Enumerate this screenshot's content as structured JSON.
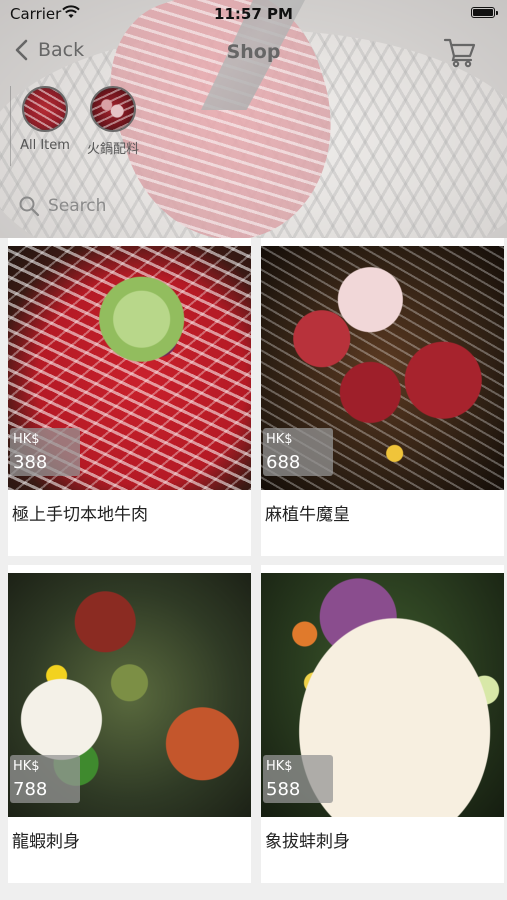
{
  "status_bar": {
    "carrier": "Carrier",
    "time": "11:57 PM"
  },
  "nav": {
    "back_label": "Back",
    "title": "Shop",
    "cart_icon": "cart-icon"
  },
  "categories": [
    {
      "label": "All Item"
    },
    {
      "label": "火鍋配料"
    }
  ],
  "search": {
    "placeholder": "Search"
  },
  "products": [
    {
      "currency": "HK$",
      "price": "388",
      "name": "極上手切本地牛肉"
    },
    {
      "currency": "HK$",
      "price": "688",
      "name": "麻植牛魔皇"
    },
    {
      "currency": "HK$",
      "price": "788",
      "name": "龍蝦刺身"
    },
    {
      "currency": "HK$",
      "price": "588",
      "name": "象拔蚌刺身"
    }
  ]
}
